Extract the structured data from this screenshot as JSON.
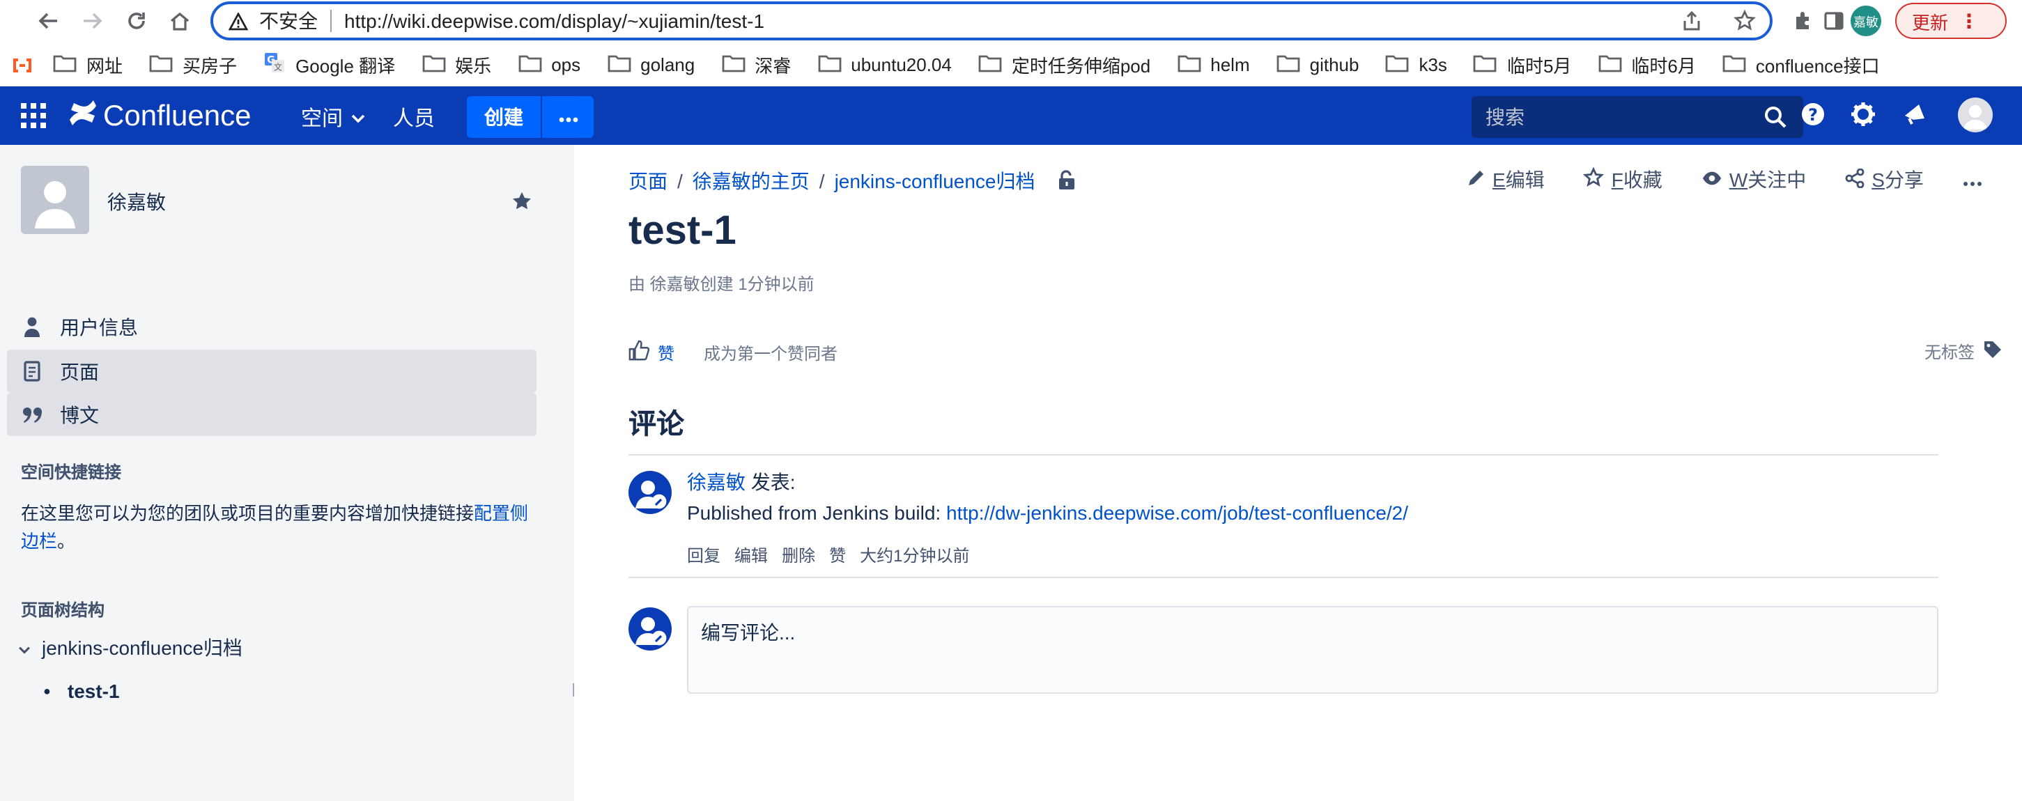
{
  "browser": {
    "insecure_label": "不安全",
    "url": "http://wiki.deepwise.com/display/~xujiamin/test-1",
    "profile_avatar": "嘉敏",
    "update_button": "更新"
  },
  "bookmarks": [
    {
      "label": "网址",
      "icon": "folder-icon"
    },
    {
      "label": "买房子",
      "icon": "folder-icon"
    },
    {
      "label": "Google 翻译",
      "icon": "google-translate-icon"
    },
    {
      "label": "娱乐",
      "icon": "folder-icon"
    },
    {
      "label": "ops",
      "icon": "folder-icon"
    },
    {
      "label": "golang",
      "icon": "folder-icon"
    },
    {
      "label": "深睿",
      "icon": "folder-icon"
    },
    {
      "label": "ubuntu20.04",
      "icon": "folder-icon"
    },
    {
      "label": "定时任务伸缩pod",
      "icon": "folder-icon"
    },
    {
      "label": "helm",
      "icon": "folder-icon"
    },
    {
      "label": "github",
      "icon": "folder-icon"
    },
    {
      "label": "k3s",
      "icon": "folder-icon"
    },
    {
      "label": "临时5月",
      "icon": "folder-icon"
    },
    {
      "label": "临时6月",
      "icon": "folder-icon"
    },
    {
      "label": "confluence接口",
      "icon": "folder-icon"
    }
  ],
  "header": {
    "logo_text": "Confluence",
    "nav_spaces": "空间",
    "nav_people": "人员",
    "create_button": "创建",
    "search_placeholder": "搜索"
  },
  "sidebar": {
    "user_name": "徐嘉敏",
    "items": [
      {
        "label": "用户信息",
        "icon": "person-icon",
        "active": false
      },
      {
        "label": "页面",
        "icon": "page-icon",
        "active": true
      },
      {
        "label": "博文",
        "icon": "quote-icon",
        "active": true
      }
    ],
    "shortcuts_title": "空间快捷链接",
    "shortcuts_desc": "在这里您可以为您的团队或项目的重要内容增加快捷链接",
    "shortcuts_link": "配置侧边栏",
    "shortcuts_period": "。",
    "tree_title": "页面树结构",
    "tree_parent": "jenkins-confluence归档",
    "tree_child": "test-1"
  },
  "page": {
    "breadcrumbs": [
      "页面",
      "徐嘉敏的主页",
      "jenkins-confluence归档"
    ],
    "actions": {
      "edit_key": "E",
      "edit_label": "编辑",
      "fav_key": "F",
      "fav_label": "收藏",
      "watch_key": "W",
      "watch_label": "关注中",
      "share_key": "S",
      "share_label": "分享"
    },
    "title": "test-1",
    "byline": "由 徐嘉敏创建 1分钟以前",
    "like_label": "赞",
    "like_prompt": "成为第一个赞同者",
    "no_labels": "无标签",
    "comments_heading": "评论"
  },
  "comment": {
    "author": "徐嘉敏",
    "posted": " 发表:",
    "body_prefix": "Published from Jenkins build: ",
    "body_link": "http://dw-jenkins.deepwise.com/job/test-confluence/2/",
    "actions": [
      "回复",
      "编辑",
      "删除",
      "赞",
      "大约1分钟以前"
    ]
  },
  "editor": {
    "placeholder": "编写评论..."
  },
  "colors": {
    "header_bg": "#0a3db5",
    "create_bg": "#0065ff",
    "link": "#0052cc",
    "sidebar_bg": "#f4f5f7"
  }
}
